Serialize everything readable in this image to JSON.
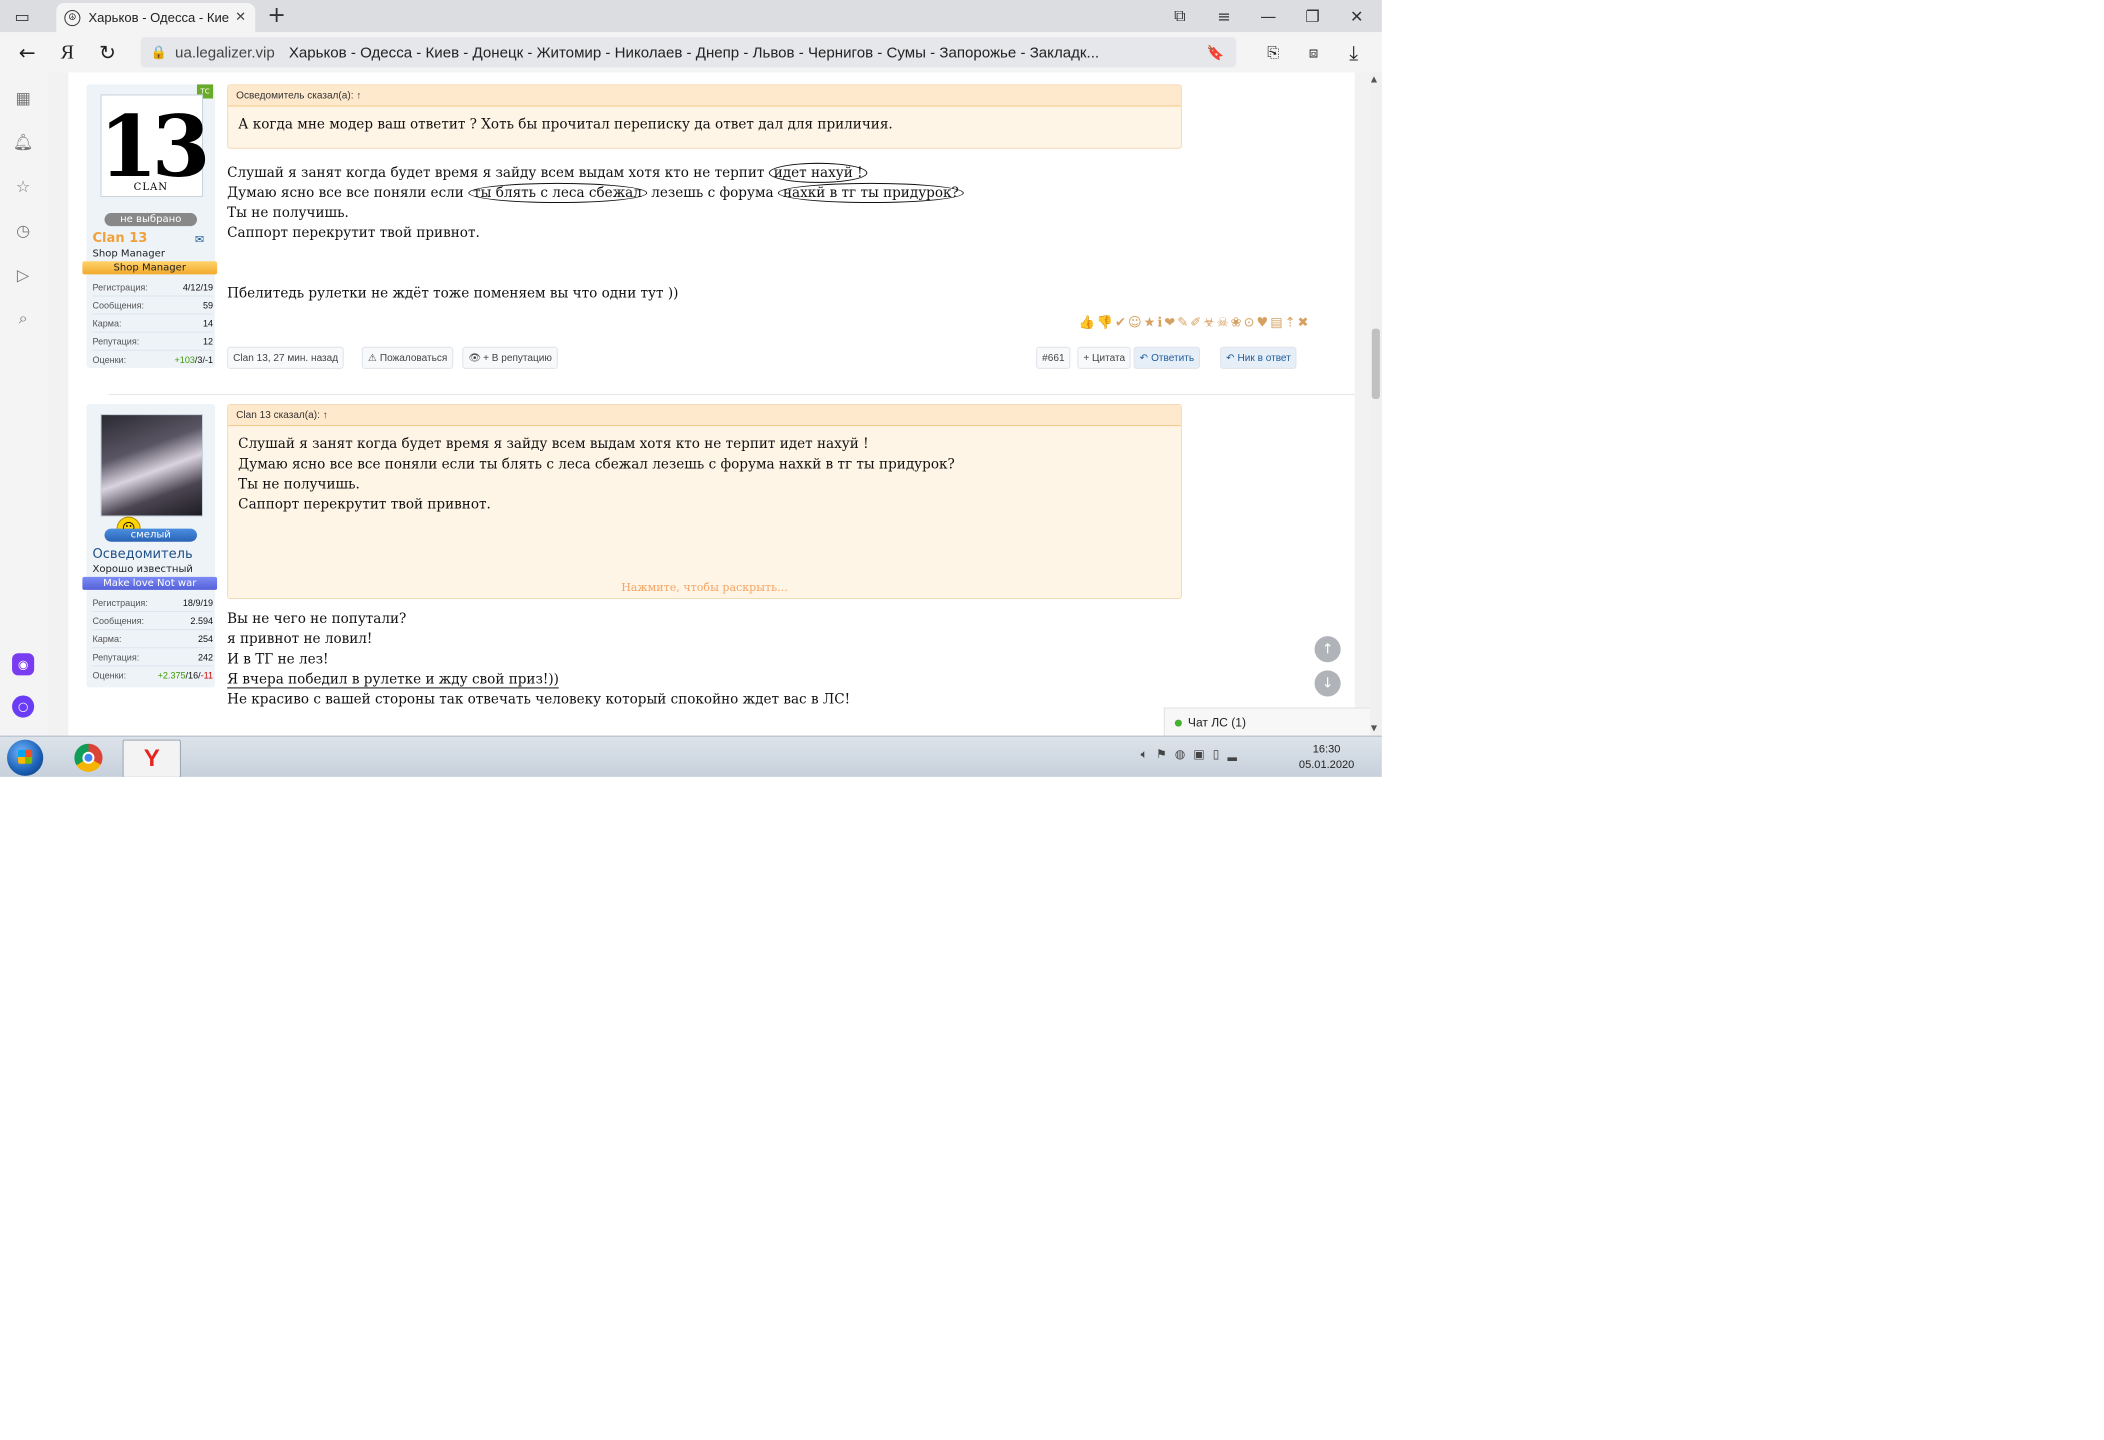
{
  "browser": {
    "tab_title": "Харьков - Одесса - Киев",
    "url_domain": "ua.legalizer.vip",
    "page_title": "Харьков - Одесса - Киев - Донецк - Житомир - Николаев - Днепр - Львов - Чернигов - Сумы - Запорожье - Закладк...",
    "yandex_label": "Я"
  },
  "posts": [
    {
      "author": {
        "name": "Clan 13",
        "ts_badge": "ТС",
        "status": "не выбрано",
        "title": "Shop Manager",
        "banner": "Shop Manager",
        "avatar_text": "13",
        "avatar_sub": "CLAN",
        "name_color": "#f0a13a",
        "stats": [
          {
            "label": "Регистрация:",
            "value": "4/12/19"
          },
          {
            "label": "Сообщения:",
            "value": "59"
          },
          {
            "label": "Карма:",
            "value": "14"
          },
          {
            "label": "Репутация:",
            "value": "12"
          }
        ],
        "ratings": {
          "label": "Оценки:",
          "pos": "+103",
          "mid": "3",
          "neg": "-1"
        }
      },
      "quote_head": "Осведомитель сказал(а): ↑",
      "quote_lines": [
        "А когда мне модер ваш ответит ? Хоть бы прочитал переписку да ответ дал для приличия."
      ],
      "line1_a": "Слушай я занят когда будет время я зайду всем выдам хотя кто не терпит ",
      "line1_c": "идет нахуй !",
      "line2_a": "Думаю ясно все все поняли если ",
      "line2_c1": "ты блять с леса сбежал",
      "line2_b": " лезешь с форума ",
      "line2_c2": "нахкй в тг ты придурок?",
      "line3": "Ты не получишь.",
      "line4": "Саппорт перекрутит твой привнот.",
      "line5": "Пбелитедь рулетки не ждёт тоже поменяем вы что одни тут ))",
      "reactions": "👍👎✔☺★ℹ❤✎✐☣☠❀⊙♥▤⇡✖",
      "footer": {
        "meta": "Clan 13, 27 мин. назад",
        "report": "Пожаловаться",
        "rep": "+ В репутацию",
        "num": "#661",
        "quote": "+ Цитата",
        "reply": "Ответить",
        "nick": "Ник в ответ"
      }
    },
    {
      "author": {
        "name": "Осведомитель",
        "status": "смелый",
        "title": "Хорошо известный",
        "banner": "Make love Not war",
        "name_color": "#1f4f86",
        "stats": [
          {
            "label": "Регистрация:",
            "value": "18/9/19"
          },
          {
            "label": "Сообщения:",
            "value": "2.594"
          },
          {
            "label": "Карма:",
            "value": "254"
          },
          {
            "label": "Репутация:",
            "value": "242"
          }
        ],
        "ratings": {
          "label": "Оценки:",
          "pos": "+2.375",
          "mid": "16",
          "neg": "-11"
        }
      },
      "quote_head": "Clan 13 сказал(а): ↑",
      "quote_lines": [
        "Слушай я занят когда будет время я зайду всем выдам хотя кто не терпит идет нахуй !",
        "Думаю ясно все все поняли если ты блять с леса сбежал лезешь с форума нахкй в тг ты придурок?",
        "Ты не получишь.",
        "Саппорт перекрутит твой привнот."
      ],
      "expand": "Нажмите, чтобы раскрыть...",
      "body_lines": [
        "Вы не чего не попутали?",
        "я привнот не ловил!",
        "И в ТГ не лез!",
        "Я вчера победил в рулетке и жду свой приз!))",
        "Не красиво с вашей стороны так отвечать человеку который спокойно ждет вас в ЛС!"
      ]
    }
  ],
  "chat": {
    "label": "Чат ЛС (1)"
  },
  "taskbar": {
    "time": "16:30",
    "date": "05.01.2020",
    "yandex": "Y"
  }
}
